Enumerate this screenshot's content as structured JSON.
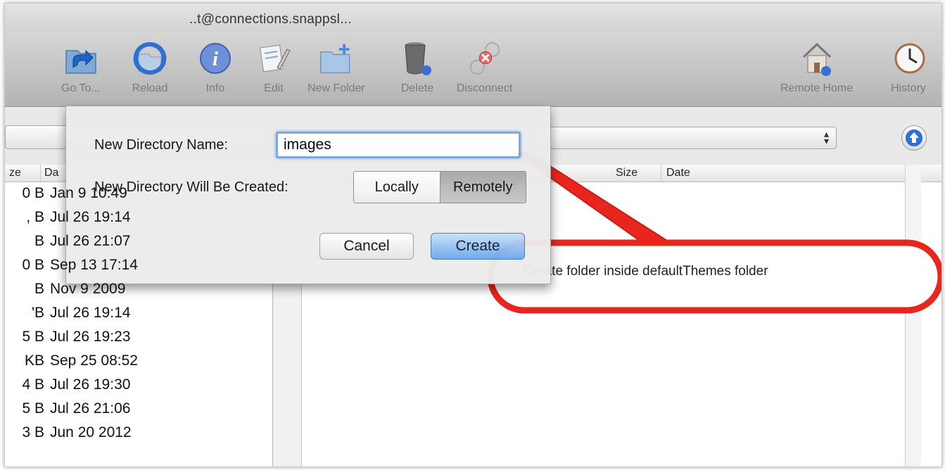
{
  "window": {
    "title_fragment": "..t@connections.snappsl..."
  },
  "toolbar": {
    "buttons": [
      {
        "label": "Go To...",
        "icon": "go-to-icon"
      },
      {
        "label": "Reload",
        "icon": "reload-icon"
      },
      {
        "label": "Info",
        "icon": "info-icon"
      },
      {
        "label": "Edit",
        "icon": "edit-icon"
      },
      {
        "label": "New Folder",
        "icon": "new-folder-icon"
      },
      {
        "label": "Delete",
        "icon": "delete-icon"
      },
      {
        "label": "Disconnect",
        "icon": "disconnect-icon"
      },
      {
        "label": "Remote Home",
        "icon": "remote-home-icon"
      },
      {
        "label": "History",
        "icon": "history-icon"
      }
    ]
  },
  "left_pane": {
    "header": {
      "size": "ze",
      "date": "Da"
    },
    "rows": [
      {
        "size": "0 B",
        "date": "Jan 9 10:49"
      },
      {
        "size": ", B",
        "date": "Jul 26 19:14"
      },
      {
        "size": "B",
        "date": "Jul 26 21:07"
      },
      {
        "size": "0 B",
        "date": "Sep 13 17:14"
      },
      {
        "size": "B",
        "date": "Nov 9 2009"
      },
      {
        "size": "'B",
        "date": "Jul 26 19:14"
      },
      {
        "size": "5 B",
        "date": "Jul 26 19:23"
      },
      {
        "size": "KB",
        "date": "Sep 25 08:52"
      },
      {
        "size": "4 B",
        "date": "Jul 26 19:30"
      },
      {
        "size": "5 B",
        "date": "Jul 26 21:06"
      },
      {
        "size": "3 B",
        "date": "Jun 20 2012"
      }
    ]
  },
  "right_pane": {
    "header": {
      "size": "Size",
      "date": "Date"
    }
  },
  "dialog": {
    "name_label": "New Directory Name:",
    "name_value": "images",
    "location_label": "New Directory Will Be Created:",
    "segments": [
      "Locally",
      "Remotely"
    ],
    "selected_segment": "Remotely",
    "cancel_label": "Cancel",
    "create_label": "Create"
  },
  "annotation": {
    "text": "Create folder inside defaultThemes folder",
    "color": "#e8261d"
  },
  "colors": {
    "accent_blue": "#6ea8ea",
    "callout_red": "#e8261d"
  }
}
